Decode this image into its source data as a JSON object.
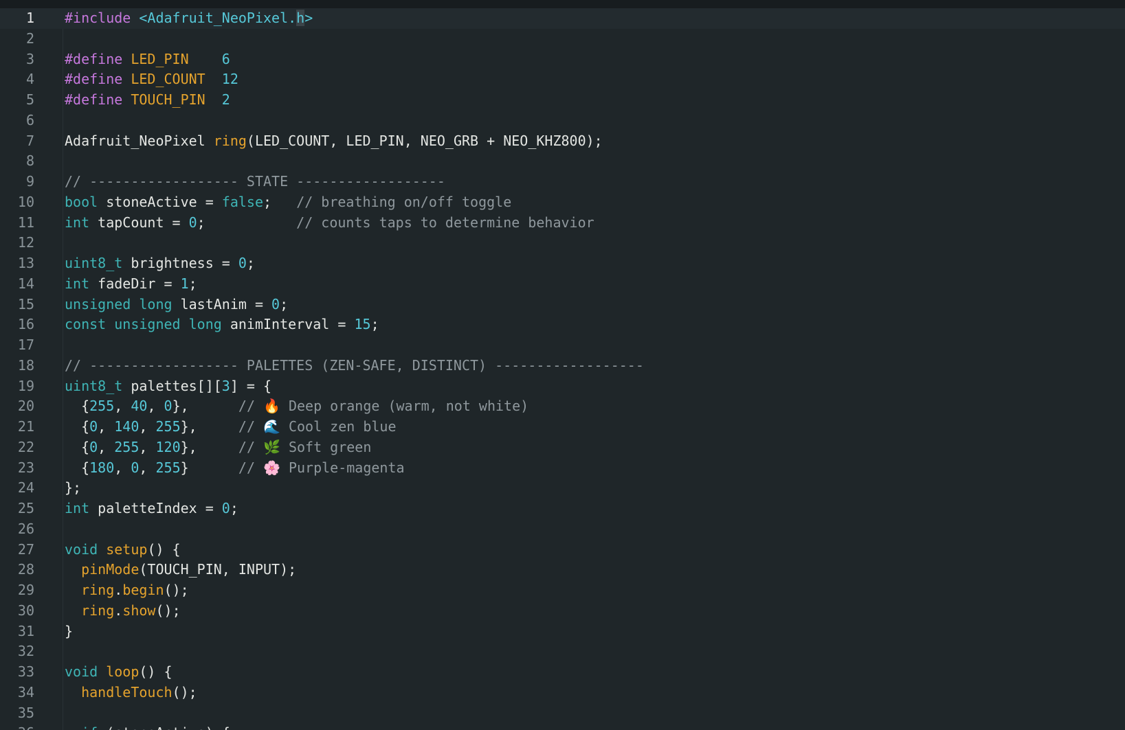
{
  "editor": {
    "current_line": 1,
    "lines": [
      {
        "n": "1",
        "tokens": [
          [
            "pre",
            "#include "
          ],
          [
            "inc",
            "<Adafruit_NeoPixel."
          ],
          [
            "cur",
            "h"
          ],
          [
            "inc",
            ">"
          ]
        ]
      },
      {
        "n": "2",
        "tokens": []
      },
      {
        "n": "3",
        "tokens": [
          [
            "pre",
            "#define "
          ],
          [
            "macro",
            "LED_PIN"
          ],
          [
            "plain",
            "    "
          ],
          [
            "num",
            "6"
          ]
        ]
      },
      {
        "n": "4",
        "tokens": [
          [
            "pre",
            "#define "
          ],
          [
            "macro",
            "LED_COUNT"
          ],
          [
            "plain",
            "  "
          ],
          [
            "num",
            "12"
          ]
        ]
      },
      {
        "n": "5",
        "tokens": [
          [
            "pre",
            "#define "
          ],
          [
            "macro",
            "TOUCH_PIN"
          ],
          [
            "plain",
            "  "
          ],
          [
            "num",
            "2"
          ]
        ]
      },
      {
        "n": "6",
        "tokens": []
      },
      {
        "n": "7",
        "tokens": [
          [
            "plain",
            "Adafruit_NeoPixel "
          ],
          [
            "fn",
            "ring"
          ],
          [
            "plain",
            "(LED_COUNT, LED_PIN, NEO_GRB + NEO_KHZ800);"
          ]
        ]
      },
      {
        "n": "8",
        "tokens": []
      },
      {
        "n": "9",
        "tokens": [
          [
            "cmt",
            "// ------------------ STATE ------------------"
          ]
        ]
      },
      {
        "n": "10",
        "tokens": [
          [
            "type",
            "bool"
          ],
          [
            "plain",
            " stoneActive = "
          ],
          [
            "type",
            "false"
          ],
          [
            "plain",
            ";   "
          ],
          [
            "cmt",
            "// breathing on/off toggle"
          ]
        ]
      },
      {
        "n": "11",
        "tokens": [
          [
            "type",
            "int"
          ],
          [
            "plain",
            " tapCount = "
          ],
          [
            "num",
            "0"
          ],
          [
            "plain",
            ";           "
          ],
          [
            "cmt",
            "// counts taps to determine behavior"
          ]
        ]
      },
      {
        "n": "12",
        "tokens": []
      },
      {
        "n": "13",
        "tokens": [
          [
            "type",
            "uint8_t"
          ],
          [
            "plain",
            " brightness = "
          ],
          [
            "num",
            "0"
          ],
          [
            "plain",
            ";"
          ]
        ]
      },
      {
        "n": "14",
        "tokens": [
          [
            "type",
            "int"
          ],
          [
            "plain",
            " fadeDir = "
          ],
          [
            "num",
            "1"
          ],
          [
            "plain",
            ";"
          ]
        ]
      },
      {
        "n": "15",
        "tokens": [
          [
            "type",
            "unsigned"
          ],
          [
            "plain",
            " "
          ],
          [
            "type",
            "long"
          ],
          [
            "plain",
            " lastAnim = "
          ],
          [
            "num",
            "0"
          ],
          [
            "plain",
            ";"
          ]
        ]
      },
      {
        "n": "16",
        "tokens": [
          [
            "type",
            "const"
          ],
          [
            "plain",
            " "
          ],
          [
            "type",
            "unsigned"
          ],
          [
            "plain",
            " "
          ],
          [
            "type",
            "long"
          ],
          [
            "plain",
            " animInterval = "
          ],
          [
            "num",
            "15"
          ],
          [
            "plain",
            ";"
          ]
        ]
      },
      {
        "n": "17",
        "tokens": []
      },
      {
        "n": "18",
        "tokens": [
          [
            "cmt",
            "// ------------------ PALETTES (ZEN-SAFE, DISTINCT) ------------------"
          ]
        ]
      },
      {
        "n": "19",
        "tokens": [
          [
            "type",
            "uint8_t"
          ],
          [
            "plain",
            " palettes[]["
          ],
          [
            "num",
            "3"
          ],
          [
            "plain",
            "] = {"
          ]
        ]
      },
      {
        "n": "20",
        "tokens": [
          [
            "plain",
            "  {"
          ],
          [
            "num",
            "255"
          ],
          [
            "plain",
            ", "
          ],
          [
            "num",
            "40"
          ],
          [
            "plain",
            ", "
          ],
          [
            "num",
            "0"
          ],
          [
            "plain",
            "},      "
          ],
          [
            "cmt",
            "// "
          ],
          [
            "emoji",
            "🔥"
          ],
          [
            "cmt",
            " Deep orange (warm, not white)"
          ]
        ]
      },
      {
        "n": "21",
        "tokens": [
          [
            "plain",
            "  {"
          ],
          [
            "num",
            "0"
          ],
          [
            "plain",
            ", "
          ],
          [
            "num",
            "140"
          ],
          [
            "plain",
            ", "
          ],
          [
            "num",
            "255"
          ],
          [
            "plain",
            "},     "
          ],
          [
            "cmt",
            "// "
          ],
          [
            "emoji",
            "🌊"
          ],
          [
            "cmt",
            " Cool zen blue"
          ]
        ]
      },
      {
        "n": "22",
        "tokens": [
          [
            "plain",
            "  {"
          ],
          [
            "num",
            "0"
          ],
          [
            "plain",
            ", "
          ],
          [
            "num",
            "255"
          ],
          [
            "plain",
            ", "
          ],
          [
            "num",
            "120"
          ],
          [
            "plain",
            "},     "
          ],
          [
            "cmt",
            "// "
          ],
          [
            "emoji",
            "🌿"
          ],
          [
            "cmt",
            " Soft green"
          ]
        ]
      },
      {
        "n": "23",
        "tokens": [
          [
            "plain",
            "  {"
          ],
          [
            "num",
            "180"
          ],
          [
            "plain",
            ", "
          ],
          [
            "num",
            "0"
          ],
          [
            "plain",
            ", "
          ],
          [
            "num",
            "255"
          ],
          [
            "plain",
            "}      "
          ],
          [
            "cmt",
            "// "
          ],
          [
            "emoji",
            "🌸"
          ],
          [
            "cmt",
            " Purple-magenta"
          ]
        ]
      },
      {
        "n": "24",
        "tokens": [
          [
            "plain",
            "};"
          ]
        ]
      },
      {
        "n": "25",
        "tokens": [
          [
            "type",
            "int"
          ],
          [
            "plain",
            " paletteIndex = "
          ],
          [
            "num",
            "0"
          ],
          [
            "plain",
            ";"
          ]
        ]
      },
      {
        "n": "26",
        "tokens": []
      },
      {
        "n": "27",
        "tokens": [
          [
            "type",
            "void"
          ],
          [
            "plain",
            " "
          ],
          [
            "fn",
            "setup"
          ],
          [
            "plain",
            "() {"
          ]
        ]
      },
      {
        "n": "28",
        "tokens": [
          [
            "plain",
            "  "
          ],
          [
            "fn",
            "pinMode"
          ],
          [
            "plain",
            "(TOUCH_PIN, INPUT);"
          ]
        ]
      },
      {
        "n": "29",
        "tokens": [
          [
            "plain",
            "  "
          ],
          [
            "fn",
            "ring"
          ],
          [
            "plain",
            "."
          ],
          [
            "fn",
            "begin"
          ],
          [
            "plain",
            "();"
          ]
        ]
      },
      {
        "n": "30",
        "tokens": [
          [
            "plain",
            "  "
          ],
          [
            "fn",
            "ring"
          ],
          [
            "plain",
            "."
          ],
          [
            "fn",
            "show"
          ],
          [
            "plain",
            "();"
          ]
        ]
      },
      {
        "n": "31",
        "tokens": [
          [
            "plain",
            "}"
          ]
        ]
      },
      {
        "n": "32",
        "tokens": []
      },
      {
        "n": "33",
        "tokens": [
          [
            "type",
            "void"
          ],
          [
            "plain",
            " "
          ],
          [
            "fn",
            "loop"
          ],
          [
            "plain",
            "() {"
          ]
        ]
      },
      {
        "n": "34",
        "tokens": [
          [
            "plain",
            "  "
          ],
          [
            "fn",
            "handleTouch"
          ],
          [
            "plain",
            "();"
          ]
        ]
      },
      {
        "n": "35",
        "tokens": []
      },
      {
        "n": "36",
        "tokens": [
          [
            "plain",
            "  "
          ],
          [
            "type",
            "if"
          ],
          [
            "plain",
            " (stoneActive) {"
          ]
        ]
      }
    ]
  },
  "colors": {
    "background": "#1f2629",
    "keyword_type": "#3fb5b6",
    "preprocessor": "#c678dd",
    "macro_function": "#e5a32d",
    "number": "#56c8d8",
    "comment": "#8f989d",
    "text": "#e4e6e3"
  }
}
